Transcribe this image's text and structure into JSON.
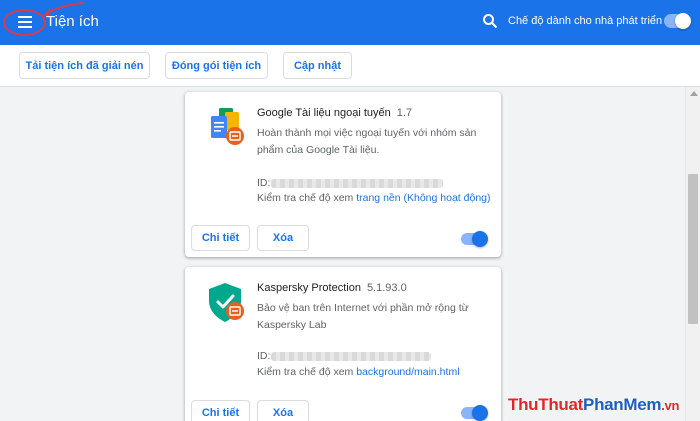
{
  "header": {
    "title": "Tiện ích",
    "dev_mode_label": "Chế độ dành cho nhà phát triển",
    "dev_mode_on": true
  },
  "toolbar": {
    "load_unpacked": "Tải tiện ích đã giải nén",
    "pack_extension": "Đóng gói tiện ích",
    "update": "Cập nhật"
  },
  "extensions": [
    {
      "name": "Google Tài liệu ngoại tuyến",
      "version": "1.7",
      "description": "Hoàn thành mọi việc ngoại tuyến với nhóm sản phẩm của Google Tài liệu.",
      "id_label": "ID:",
      "inspect_label": "Kiểm tra chế độ xem",
      "inspect_link": "trang nền (Không hoạt động)",
      "details_label": "Chi tiết",
      "remove_label": "Xóa",
      "enabled": true,
      "icon": "google-docs-offline-icon"
    },
    {
      "name": "Kaspersky Protection",
      "version": "5.1.93.0",
      "description": "Bảo vệ ban trên Internet với phần mở rộng từ Kaspersky Lab",
      "id_label": "ID:",
      "inspect_label": "Kiểm tra chế độ xem",
      "inspect_link": "background/main.html",
      "details_label": "Chi tiết",
      "remove_label": "Xóa",
      "enabled": true,
      "icon": "kaspersky-shield-icon"
    }
  ],
  "watermark": {
    "part1": "ThuThuat",
    "part2": "PhanMem",
    "part3": ".vn"
  },
  "colors": {
    "accent": "#1a73e8",
    "annotation": "#d93a4a"
  }
}
